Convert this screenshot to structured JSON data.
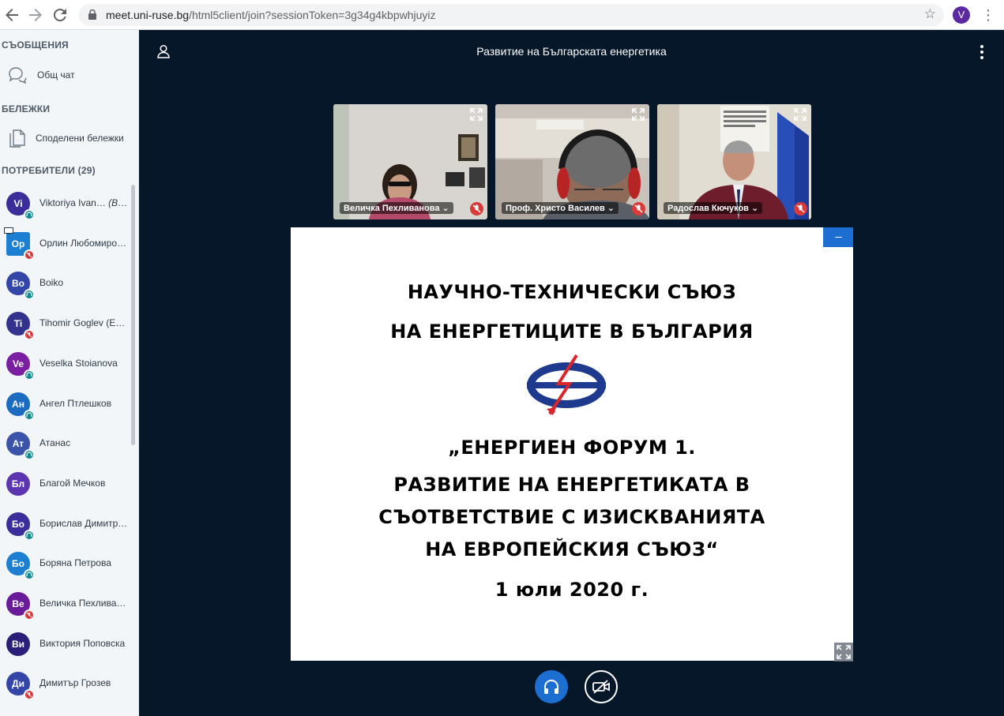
{
  "browser": {
    "url_host": "meet.uni-ruse.bg",
    "url_path": "/html5client/join?sessionToken=3g34g4kbpwhjuyiz",
    "profile_initial": "V",
    "icons": [
      "back-icon",
      "forward-icon",
      "reload-icon",
      "lock-icon",
      "star-icon",
      "chrome-menu-icon"
    ]
  },
  "sidebar": {
    "messages_title": "СЪОБЩЕНИЯ",
    "public_chat": "Общ чат",
    "notes_title": "БЕЛЕЖКИ",
    "shared_notes": "Споделени бележки",
    "users_title": "ПОТРЕБИТЕЛИ (29)",
    "users": [
      {
        "initials": "Vi",
        "name": "Viktoriya Ivan…",
        "you": "(Вие)",
        "color": "#3b2e9a",
        "status": "listen"
      },
      {
        "initials": "Op",
        "name": "Орлин Любомиро…",
        "you": "",
        "color": "#1c7fd1",
        "status": "muted",
        "presenter": true
      },
      {
        "initials": "Bo",
        "name": "Boiko",
        "you": "",
        "color": "#3445a8",
        "status": "listen"
      },
      {
        "initials": "Ti",
        "name": "Tihomir Goglev (ESO)",
        "you": "",
        "color": "#33338f",
        "status": "muted"
      },
      {
        "initials": "Ve",
        "name": "Veselka Stoianova",
        "you": "",
        "color": "#7b1fa2",
        "status": "listen"
      },
      {
        "initials": "Ан",
        "name": "Ангел Птлешков",
        "you": "",
        "color": "#1b6cc1",
        "status": "listen"
      },
      {
        "initials": "Ат",
        "name": "Атанас",
        "you": "",
        "color": "#3b53a8",
        "status": "listen"
      },
      {
        "initials": "Бл",
        "name": "Благой Мечков",
        "you": "",
        "color": "#5e35b1",
        "status": "none"
      },
      {
        "initials": "Бо",
        "name": "Борислав Димитр…",
        "you": "",
        "color": "#3b2e9a",
        "status": "listen"
      },
      {
        "initials": "Бо",
        "name": "Боряна Петрова",
        "you": "",
        "color": "#1c7fd1",
        "status": "listen"
      },
      {
        "initials": "Ве",
        "name": "Величка Пехлива…",
        "you": "",
        "color": "#6a1b9a",
        "status": "muted"
      },
      {
        "initials": "Ви",
        "name": "Виктория Поповска",
        "you": "",
        "color": "#2c1f7a",
        "status": "none"
      },
      {
        "initials": "Ди",
        "name": "Димитър Грозев",
        "you": "",
        "color": "#3445a8",
        "status": "muted"
      }
    ]
  },
  "main": {
    "title": "Развитие на Българската енергетика",
    "webcams": [
      {
        "name": "Величка Пехливанова"
      },
      {
        "name": "Проф. Христо Василев"
      },
      {
        "name": "Радослав Кючуков"
      }
    ],
    "slide": {
      "lines": [
        "НАУЧНО-ТЕХНИЧЕСКИ СЪЮЗ",
        "НА ЕНЕРГЕТИЦИТЕ В БЪЛГАРИЯ",
        "„ЕНЕРГИЕН ФОРУМ 1.",
        "РАЗВИТИЕ НА ЕНЕРГЕТИКАТА В",
        "СЪОТВЕТСТВИЕ С ИЗИСКВАНИЯТА",
        "НА ЕВРОПЕЙСКИЯ СЪЮЗ“",
        "1 юли 2020 г."
      ]
    }
  },
  "colors": {
    "accent": "#1c6fd1",
    "main_bg": "#06172a",
    "sidebar_bg": "#f3f6f9",
    "muted": "#d93a3a",
    "listen": "#0f8b8d"
  }
}
